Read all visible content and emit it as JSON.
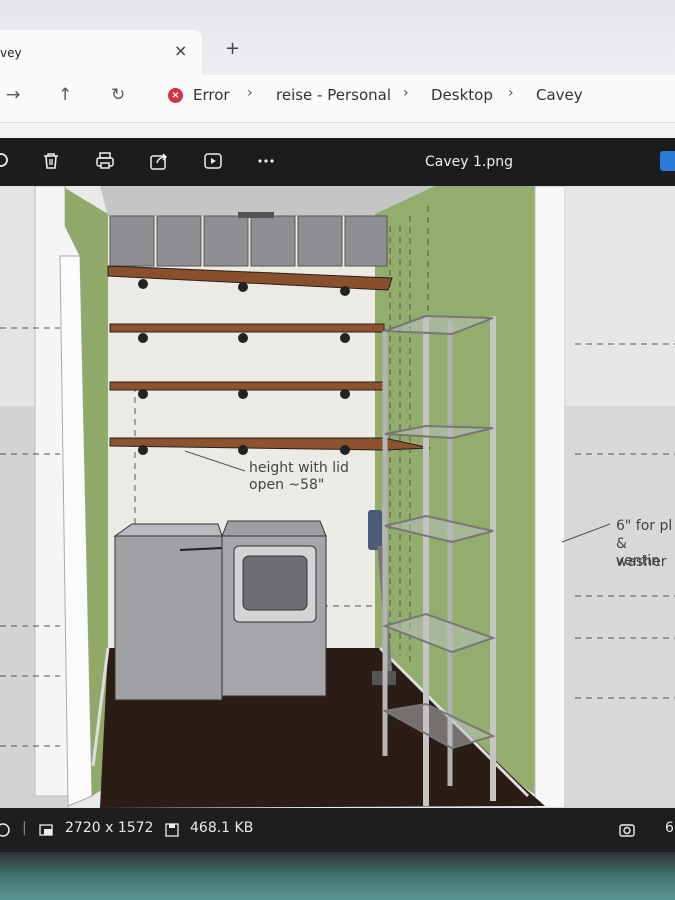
{
  "browser": {
    "tab_title": "vey",
    "new_tab_label": "+",
    "close_label": "×"
  },
  "addressbar": {
    "error_label": "Error",
    "crumbs": [
      "reise - Personal",
      "Desktop",
      "Cavey"
    ]
  },
  "viewer": {
    "file_name": "Cavey 1.png",
    "tools": [
      "delete-icon",
      "print-icon",
      "share-icon",
      "slideshow-icon",
      "more-icon"
    ]
  },
  "image": {
    "annotation_lid": "height with lid\nopen ~58\"",
    "annotation_right_1": "6\" for pl",
    "annotation_right_2": "& ventin",
    "annotation_right_3": "washer"
  },
  "status": {
    "dimensions": "2720 x 1572",
    "file_size": "468.1 KB",
    "zoom_partial": "6"
  },
  "colors": {
    "wall_green": "#8fac6a",
    "floor": "#2a1a14",
    "shelf_wood": "#9a5a32",
    "toolbar": "#1c1c1e"
  }
}
